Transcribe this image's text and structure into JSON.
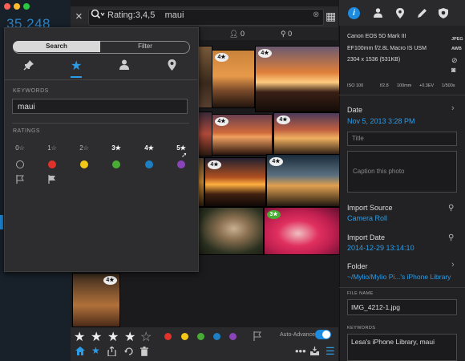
{
  "window": {
    "traffic_lights": {
      "close": "#fc5f57",
      "minimize": "#fdbc2e",
      "zoom": "#28c840"
    },
    "left_count": "35,248"
  },
  "search": {
    "close_icon": "×",
    "query_label": "Rating:3,4,5",
    "query_text": "maui",
    "clear_icon": "⊗",
    "grid_icon": "▦"
  },
  "counts": {
    "people": "0",
    "places": "0"
  },
  "panel": {
    "tabs": {
      "search": "Search",
      "filter": "Filter"
    },
    "icons": [
      "pin-icon",
      "star-icon",
      "person-icon",
      "location-icon"
    ],
    "keywords_label": "KEYWORDS",
    "keywords_value": "maui",
    "ratings_label": "RATINGS",
    "ratings": [
      "0☆",
      "1☆",
      "2☆",
      "3★",
      "4★",
      "5★"
    ],
    "colors": [
      "none",
      "#e0322b",
      "#f3c817",
      "#48ac35",
      "#1d7fc1",
      "#8a44b9"
    ]
  },
  "bottom": {
    "stars": [
      "★",
      "★",
      "★",
      "★",
      "☆"
    ],
    "colors": [
      "#e0322b",
      "#f3c817",
      "#48ac35",
      "#1d7fc1",
      "#8a44b9"
    ],
    "auto_advance": "Auto-Advance"
  },
  "inspector": {
    "camera": "Canon EOS 5D Mark III",
    "lens": "EF100mm f/2.8L Macro IS USM",
    "dimensions": "2304 x 1536 (531KB)",
    "format_badges": [
      "JPEG",
      "AWB"
    ],
    "exposure": [
      "ISO 100",
      "f/2.8",
      "100mm",
      "+0.3EV",
      "1/500s"
    ],
    "date_label": "Date",
    "date_value": "Nov 5, 2013 3:28 PM",
    "title_placeholder": "Title",
    "caption_placeholder": "Caption this photo",
    "import_source_label": "Import Source",
    "import_source_value": "Camera Roll",
    "import_date_label": "Import Date",
    "import_date_value": "2014-12-29 13:14:10",
    "folder_label": "Folder",
    "folder_value": "~/Mylio/Mylio Pi...'s iPhone Library",
    "filename_label": "FILE NAME",
    "filename_value": "IMG_4212-1.jpg",
    "keywords_label": "KEYWORDS",
    "keywords_value": "Lesa's iPhone Library, maui"
  },
  "photo_badges": [
    "4★",
    "4★",
    "4★",
    "4★",
    "4★",
    "4★",
    "4★",
    "3★",
    "4★"
  ]
}
